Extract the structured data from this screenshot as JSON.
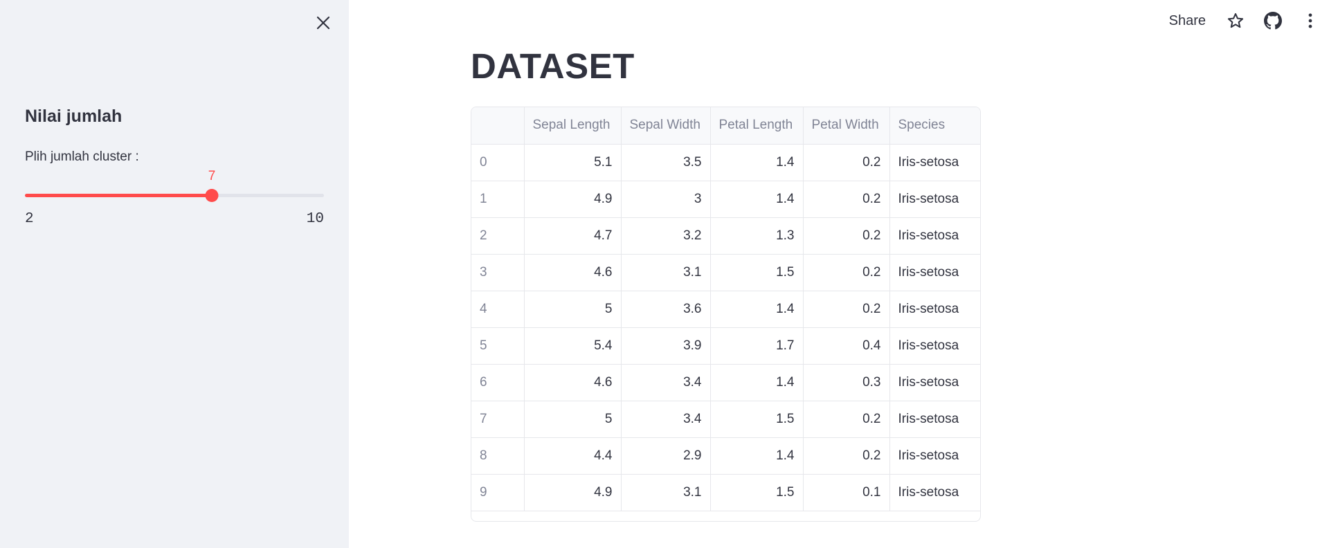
{
  "sidebar": {
    "title": "Nilai jumlah",
    "slider": {
      "label": "Plih jumlah cluster :",
      "value": "7",
      "min": "2",
      "max": "10"
    }
  },
  "toolbar": {
    "share_label": "Share",
    "icons": [
      "star-icon",
      "github-icon",
      "more-vertical-icon"
    ]
  },
  "main": {
    "title": "DATASET",
    "table": {
      "columns": [
        "",
        "Sepal Length",
        "Sepal Width",
        "Petal Length",
        "Petal Width",
        "Species"
      ],
      "rows": [
        [
          "0",
          "5.1",
          "3.5",
          "1.4",
          "0.2",
          "Iris-setosa"
        ],
        [
          "1",
          "4.9",
          "3",
          "1.4",
          "0.2",
          "Iris-setosa"
        ],
        [
          "2",
          "4.7",
          "3.2",
          "1.3",
          "0.2",
          "Iris-setosa"
        ],
        [
          "3",
          "4.6",
          "3.1",
          "1.5",
          "0.2",
          "Iris-setosa"
        ],
        [
          "4",
          "5",
          "3.6",
          "1.4",
          "0.2",
          "Iris-setosa"
        ],
        [
          "5",
          "5.4",
          "3.9",
          "1.7",
          "0.4",
          "Iris-setosa"
        ],
        [
          "6",
          "4.6",
          "3.4",
          "1.4",
          "0.3",
          "Iris-setosa"
        ],
        [
          "7",
          "5",
          "3.4",
          "1.5",
          "0.2",
          "Iris-setosa"
        ],
        [
          "8",
          "4.4",
          "2.9",
          "1.4",
          "0.2",
          "Iris-setosa"
        ],
        [
          "9",
          "4.9",
          "3.1",
          "1.5",
          "0.1",
          "Iris-setosa"
        ]
      ]
    }
  },
  "colors": {
    "accent": "#ff4b4b",
    "sidebar_bg": "#f0f2f6",
    "text": "#31333f",
    "muted": "#808495"
  }
}
